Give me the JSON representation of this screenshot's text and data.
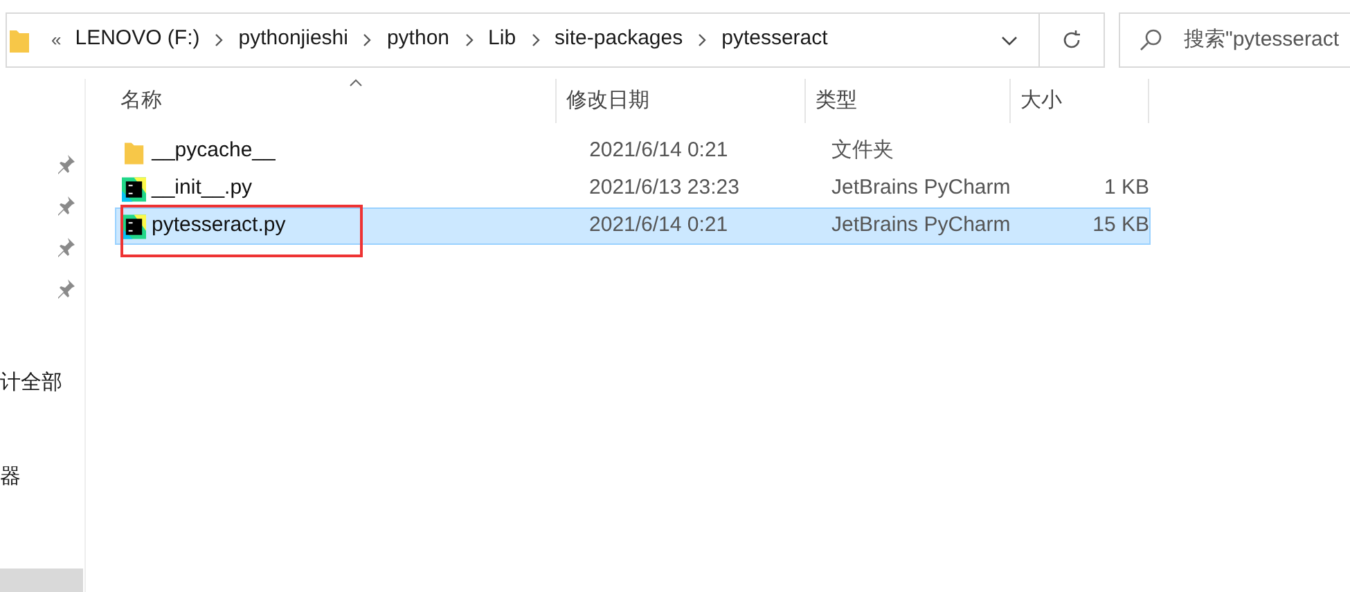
{
  "address_bar": {
    "overflow": "«",
    "path": [
      "LENOVO (F:)",
      "pythonjieshi",
      "python",
      "Lib",
      "site-packages",
      "pytesseract"
    ]
  },
  "search": {
    "placeholder": "搜索\"pytesseract"
  },
  "sidebar": {
    "pinned_count_items": [
      {
        "pinned": true
      },
      {
        "pinned": true
      },
      {
        "pinned": true
      },
      {
        "pinned": true
      }
    ],
    "items": [
      {
        "label": "计全部",
        "selected": false
      },
      {
        "label": "器",
        "selected": false
      },
      {
        "selected": true
      }
    ]
  },
  "columns": [
    {
      "label": "名称",
      "sorted": true
    },
    {
      "label": "修改日期",
      "sorted": false
    },
    {
      "label": "类型",
      "sorted": false
    },
    {
      "label": "大小",
      "sorted": false
    }
  ],
  "files": [
    {
      "kind": "folder",
      "name": "__pycache__",
      "modified": "2021/6/14 0:21",
      "type": "文件夹",
      "selected": false,
      "highlighted": false
    },
    {
      "kind": "pycharm",
      "name": "__init__.py",
      "modified": "2021/6/13 23:23",
      "type": "JetBrains PyCharm",
      "size": "1 KB",
      "selected": false,
      "highlighted": false
    },
    {
      "kind": "pycharm",
      "name": "pytesseract.py",
      "modified": "2021/6/14 0:21",
      "type": "JetBrains PyCharm",
      "size": "15 KB",
      "selected": true,
      "highlighted": true
    }
  ]
}
